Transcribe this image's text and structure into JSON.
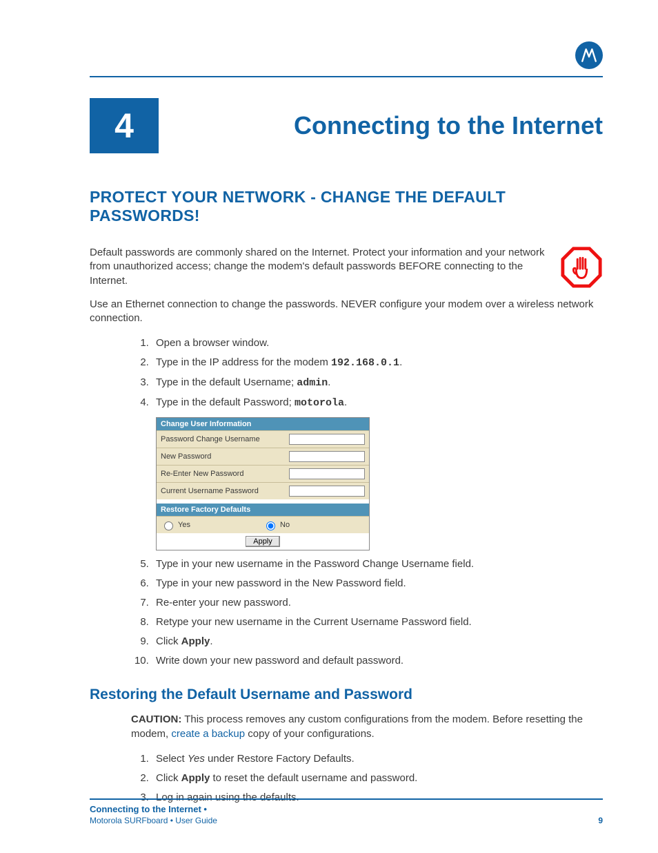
{
  "chapter": {
    "number": "4",
    "title": "Connecting to the Internet"
  },
  "h2": "PROTECT YOUR NETWORK - CHANGE THE DEFAULT PASSWORDS!",
  "para1": "Default passwords are commonly shared on the Internet. Protect your information and your network from unauthorized access; change the modem's default passwords BEFORE connecting to the Internet.",
  "para2": "Use an Ethernet connection to change the passwords. NEVER configure your modem over a wireless network connection.",
  "steps_a": {
    "s1": "Open a browser window.",
    "s2_pre": "Type in the IP address for the modem ",
    "s2_ip": "192.168.0.1",
    "s2_post": ".",
    "s3_pre": "Type in the default Username; ",
    "s3_val": "admin",
    "s3_post": ".",
    "s4_pre": "Type in the default Password; ",
    "s4_val": "motorola",
    "s4_post": "."
  },
  "modem": {
    "header1": "Change User Information",
    "row1": "Password Change Username",
    "row2": "New Password",
    "row3": "Re-Enter New Password",
    "row4": "Current Username Password",
    "header2": "Restore Factory Defaults",
    "yes": "Yes",
    "no": "No",
    "apply": "Apply"
  },
  "steps_b": {
    "s5": "Type in your new username in the Password Change Username field.",
    "s6": "Type in your new password in the New Password field.",
    "s7": "Re-enter your new password.",
    "s8": "Retype your new username in the Current Username Password field.",
    "s9_pre": "Click ",
    "s9_bold": "Apply",
    "s9_post": ".",
    "s10": "Write down your new password and default password."
  },
  "h3": "Restoring the Default Username and Password",
  "caution": {
    "label": "CAUTION:",
    "text1": " This process removes any custom configurations from the modem. Before resetting the modem, ",
    "link": "create a backup",
    "text2": " copy of your configurations."
  },
  "restore_steps": {
    "r1_pre": "Select ",
    "r1_ital": "Yes",
    "r1_post": " under Restore Factory Defaults.",
    "r2_pre": "Click ",
    "r2_bold": "Apply",
    "r2_post": " to reset the default username and password.",
    "r3": "Log in again using the defaults."
  },
  "footer": {
    "breadcrumb": "Connecting to the Internet •",
    "guide": "Motorola SURFboard • User Guide",
    "page": "9"
  }
}
